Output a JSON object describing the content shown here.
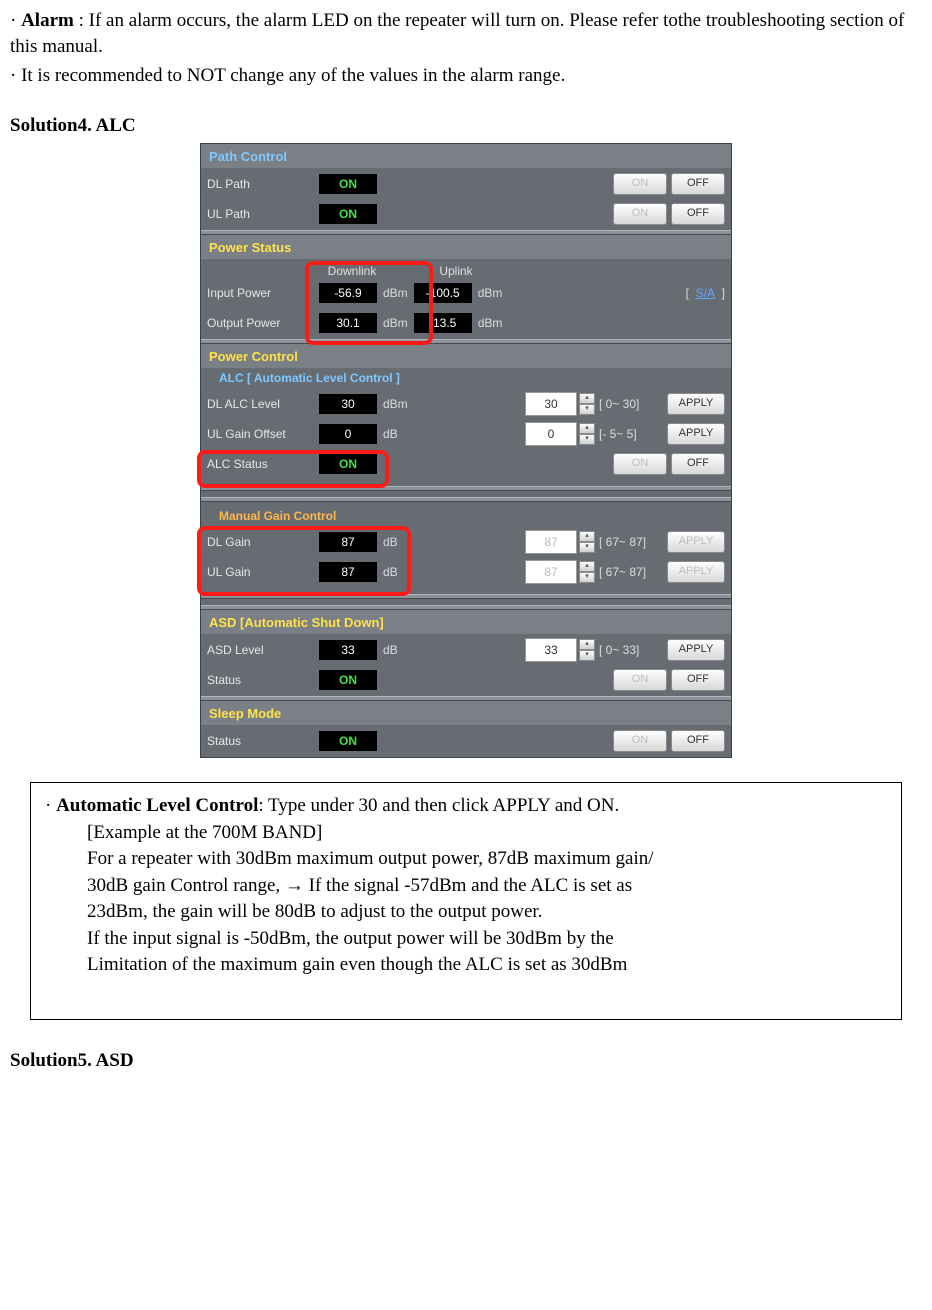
{
  "topText": {
    "alarm_label": "Alarm",
    "alarm_rest": " : If an alarm occurs, the alarm LED on the repeater will turn on. Please refer tothe troubleshooting section of this manual.",
    "line2": "· It is recommended to NOT change   any of the values in the alarm range."
  },
  "section4": "Solution4. ALC",
  "ui": {
    "pathControl": {
      "title": "Path Control",
      "dl_label": "DL Path",
      "ul_label": "UL Path",
      "dl_val": "ON",
      "ul_val": "ON",
      "btn_on": "ON",
      "btn_off": "OFF"
    },
    "powerStatus": {
      "title": "Power Status",
      "col_dl": "Downlink",
      "col_ul": "Uplink",
      "row1_label": "Input Power",
      "row1_dl": "-56.9",
      "row1_ul": "-100.5",
      "row2_label": "Output Power",
      "row2_dl": "30.1",
      "row2_ul": "-13.5",
      "unit": "dBm",
      "sa": "S/A"
    },
    "powerControl": {
      "title": "Power Control",
      "alc_sub": "ALC [ Automatic Level Control ]",
      "dl_alc_label": "DL ALC Level",
      "dl_alc_val": "30",
      "dl_alc_unit": "dBm",
      "dl_alc_input": "30",
      "dl_alc_range": "[ 0~ 30]",
      "ul_off_label": "UL Gain Offset",
      "ul_off_val": "0",
      "ul_off_unit": "dB",
      "ul_off_input": "0",
      "ul_off_range": "[- 5~  5]",
      "alc_status_label": "ALC Status",
      "alc_status_val": "ON",
      "btn_on": "ON",
      "btn_off": "OFF",
      "btn_apply": "APPLY"
    },
    "manualGain": {
      "title": "Manual Gain Control",
      "dl_label": "DL Gain",
      "dl_val": "87",
      "dl_unit": "dB",
      "dl_input": "87",
      "dl_range": "[ 67~ 87]",
      "ul_label": "UL Gain",
      "ul_val": "87",
      "ul_unit": "dB",
      "ul_input": "87",
      "ul_range": "[ 67~ 87]",
      "btn_apply": "APPLY"
    },
    "asd": {
      "title": "ASD [Automatic Shut Down]",
      "asd_label": "ASD Level",
      "asd_val": "33",
      "asd_unit": "dB",
      "asd_input": "33",
      "asd_range": "[ 0~ 33]",
      "status_label": "Status",
      "status_val": "ON",
      "btn_on": "ON",
      "btn_off": "OFF",
      "btn_apply": "APPLY"
    },
    "sleep": {
      "title": "Sleep Mode",
      "status_label": "Status",
      "status_val": "ON",
      "btn_on": "ON",
      "btn_off": "OFF"
    }
  },
  "box": {
    "lead_bold": "Automatic Level Control",
    "lead_rest": ": Type under 30 and then click APPLY and ON.",
    "l1": "[Example at the 700M BAND]",
    "l2": "For a repeater with 30dBm maximum output power, 87dB maximum gain/",
    "l3": "30dB gain Control range, → If the signal -57dBm and the ALC is set as",
    "l4": "23dBm, the gain will be 80dB to adjust to the output power.",
    "l5": "If the input signal is -50dBm, the output power will be 30dBm by the",
    "l6": "Limitation of the maximum gain even though the ALC is set as 30dBm"
  },
  "section5": "Solution5. ASD"
}
